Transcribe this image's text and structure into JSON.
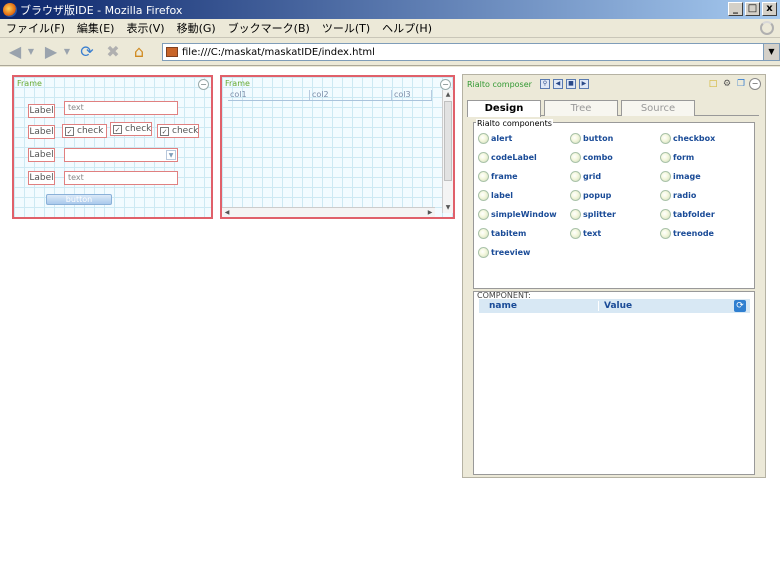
{
  "window": {
    "title": "ブラウザ版IDE - Mozilla Firefox",
    "controls": {
      "minimize": "_",
      "maximize": "□",
      "close": "x"
    }
  },
  "menubar": {
    "items": [
      "ファイル(F)",
      "編集(E)",
      "表示(V)",
      "移動(G)",
      "ブックマーク(B)",
      "ツール(T)",
      "ヘルプ(H)"
    ]
  },
  "navbar": {
    "url": "file:///C:/maskat/maskatIDE/index.html"
  },
  "frame1": {
    "title": "Frame",
    "label1": "Label",
    "text1": "text",
    "label2": "Label",
    "check1": "check",
    "check2": "check",
    "check3": "check",
    "label3": "Label",
    "label4": "Label",
    "text2": "text",
    "button": "button"
  },
  "frame2": {
    "title": "Frame",
    "columns": [
      "col1",
      "col2",
      "col3"
    ]
  },
  "composer": {
    "title": "Rialto composer",
    "tabs": [
      "Design",
      "Tree",
      "Source"
    ],
    "components_title": "Rialto components",
    "components": [
      "alert",
      "button",
      "checkbox",
      "codeLabel",
      "combo",
      "form",
      "frame",
      "grid",
      "image",
      "label",
      "popup",
      "radio",
      "simpleWindow",
      "splitter",
      "tabfolder",
      "tabitem",
      "text",
      "treenode",
      "treeview"
    ],
    "component_title": "COMPONENT:",
    "prop_name": "name",
    "prop_value": "Value"
  },
  "colors": {
    "frame_border": "#e0606a",
    "component_text": "#1a4b97",
    "title_green": "#339933"
  }
}
